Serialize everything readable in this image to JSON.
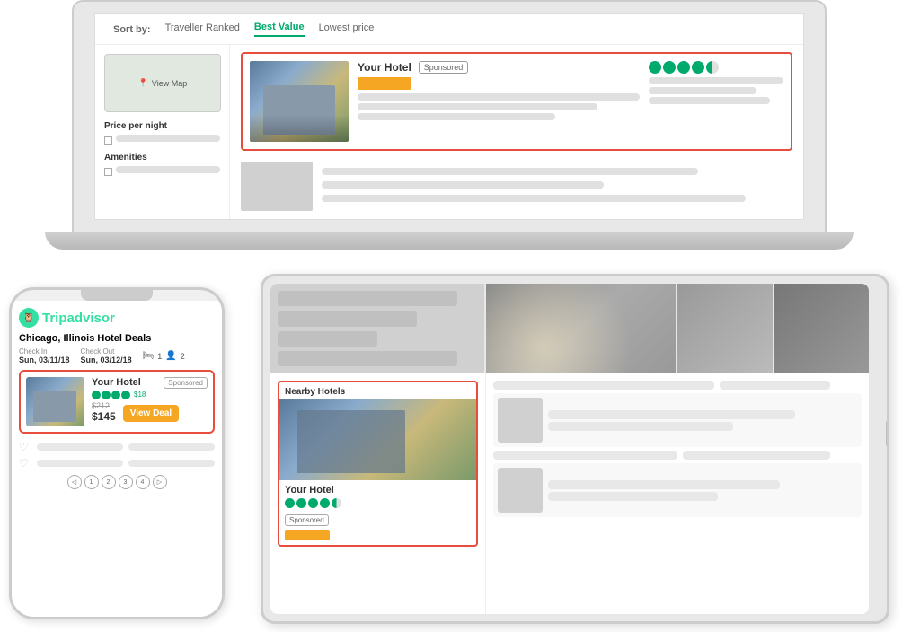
{
  "laptop": {
    "sort_label": "Sort by:",
    "tab_traveller": "Traveller Ranked",
    "tab_best_value": "Best Value",
    "tab_lowest": "Lowest price",
    "view_map": "View Map",
    "price_per_night": "Price per night",
    "amenities": "Amenities",
    "hotel_name": "Your Hotel",
    "sponsored": "Sponsored",
    "bubbles_count": 4,
    "bubble_half": true
  },
  "phone": {
    "brand": "Tripadvisor",
    "city": "Chicago, Illinois Hotel Deals",
    "checkin_label": "Check In",
    "checkin_value": "Sun, 03/11/18",
    "checkout_label": "Check Out",
    "checkout_value": "Sun, 03/12/18",
    "rooms": "1",
    "guests": "2",
    "hotel_name": "Your Hotel",
    "sponsored": "Sponsored",
    "bubbles_count": 4,
    "reviews": "$18",
    "price_old": "$212",
    "price_new": "$145",
    "view_deal": "View Deal",
    "pagination": [
      "◁",
      "1",
      "2",
      "3",
      "4",
      "▷"
    ]
  },
  "tablet": {
    "nearby_title": "Nearby Hotels",
    "hotel_name": "Your Hotel",
    "sponsored": "Sponsored",
    "bubbles_count": 4,
    "bubble_half": true
  }
}
